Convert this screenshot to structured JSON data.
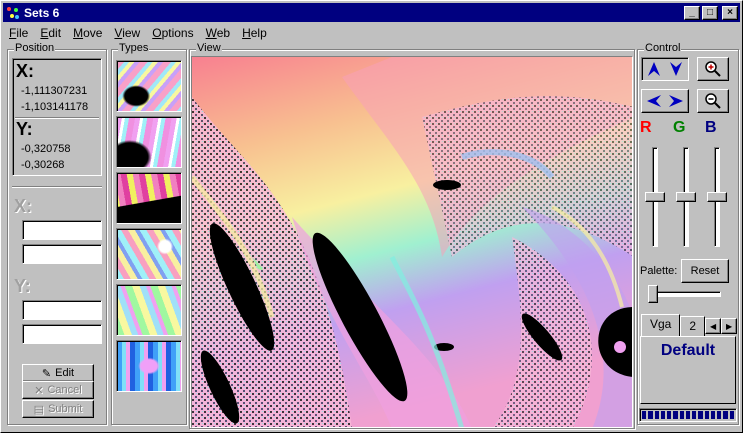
{
  "window": {
    "title": "Sets 6",
    "minimize": "_",
    "maximize": "□",
    "close": "×"
  },
  "menu": [
    {
      "label": "File",
      "mnemonic": "F",
      "rest": "ile"
    },
    {
      "label": "Edit",
      "mnemonic": "E",
      "rest": "dit"
    },
    {
      "label": "Move",
      "mnemonic": "M",
      "rest": "ove"
    },
    {
      "label": "View",
      "mnemonic": "V",
      "rest": "iew"
    },
    {
      "label": "Options",
      "mnemonic": "O",
      "rest": "ptions"
    },
    {
      "label": "Web",
      "mnemonic": "W",
      "rest": "eb"
    },
    {
      "label": "Help",
      "mnemonic": "H",
      "rest": "elp"
    }
  ],
  "position": {
    "label": "Position",
    "x_label": "X:",
    "x_min": "-1,111307231",
    "x_max": "-1,103141178",
    "y_label": "Y:",
    "y_min": "-0,320758",
    "y_max": "-0,30268",
    "edit_x_label": "X:",
    "edit_y_label": "Y:",
    "edit_x1": "",
    "edit_x2": "",
    "edit_y1": "",
    "edit_y2": "",
    "edit_button": "Edit",
    "cancel_button": "Cancel",
    "submit_button": "Submit"
  },
  "types": {
    "label": "Types",
    "count": 6
  },
  "view": {
    "label": "View"
  },
  "control": {
    "label": "Control",
    "r_label": "R",
    "g_label": "G",
    "b_label": "B",
    "r_color": "#ff0000",
    "g_color": "#008000",
    "b_color": "#000080",
    "r_level": 0.5,
    "g_level": 0.5,
    "b_level": 0.5,
    "palette_label": "Palette:",
    "reset_button": "Reset",
    "palette_level": 0.0,
    "tabs": [
      "Vga",
      "2"
    ],
    "active_tab": "Vga",
    "palette_name": "Default",
    "progress_blocks": 15
  },
  "icons": {
    "up": "arrow-up-icon",
    "down": "arrow-down-icon",
    "left": "arrow-left-icon",
    "right": "arrow-right-icon",
    "zoom_in": "zoom-in-icon",
    "zoom_out": "zoom-out-icon"
  }
}
